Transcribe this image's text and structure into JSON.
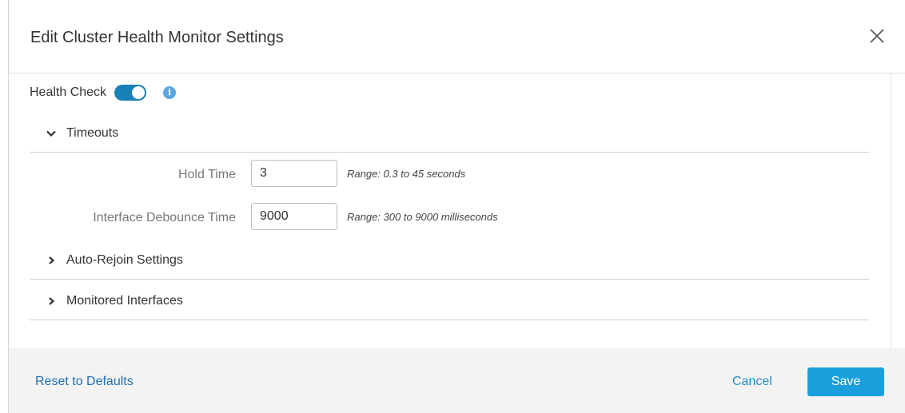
{
  "dialog": {
    "title": "Edit Cluster Health Monitor Settings",
    "close_icon": "close-icon"
  },
  "health_check": {
    "label": "Health Check",
    "enabled": true,
    "toggle_color": "#1a81b6",
    "info_icon": "info-icon",
    "info_glyph": "i"
  },
  "sections": {
    "timeouts": {
      "label": "Timeouts",
      "expanded": true,
      "fields": {
        "hold_time": {
          "label": "Hold Time",
          "value": "3",
          "hint": "Range: 0.3 to 45 seconds"
        },
        "debounce": {
          "label": "Interface Debounce Time",
          "value": "9000",
          "hint": "Range: 300 to 9000 milliseconds"
        }
      }
    },
    "auto_rejoin": {
      "label": "Auto-Rejoin Settings",
      "expanded": false
    },
    "monitored": {
      "label": "Monitored Interfaces",
      "expanded": false
    }
  },
  "footer": {
    "reset_label": "Reset to Defaults",
    "cancel_label": "Cancel",
    "save_label": "Save",
    "accent_color": "#1a9fdd"
  }
}
